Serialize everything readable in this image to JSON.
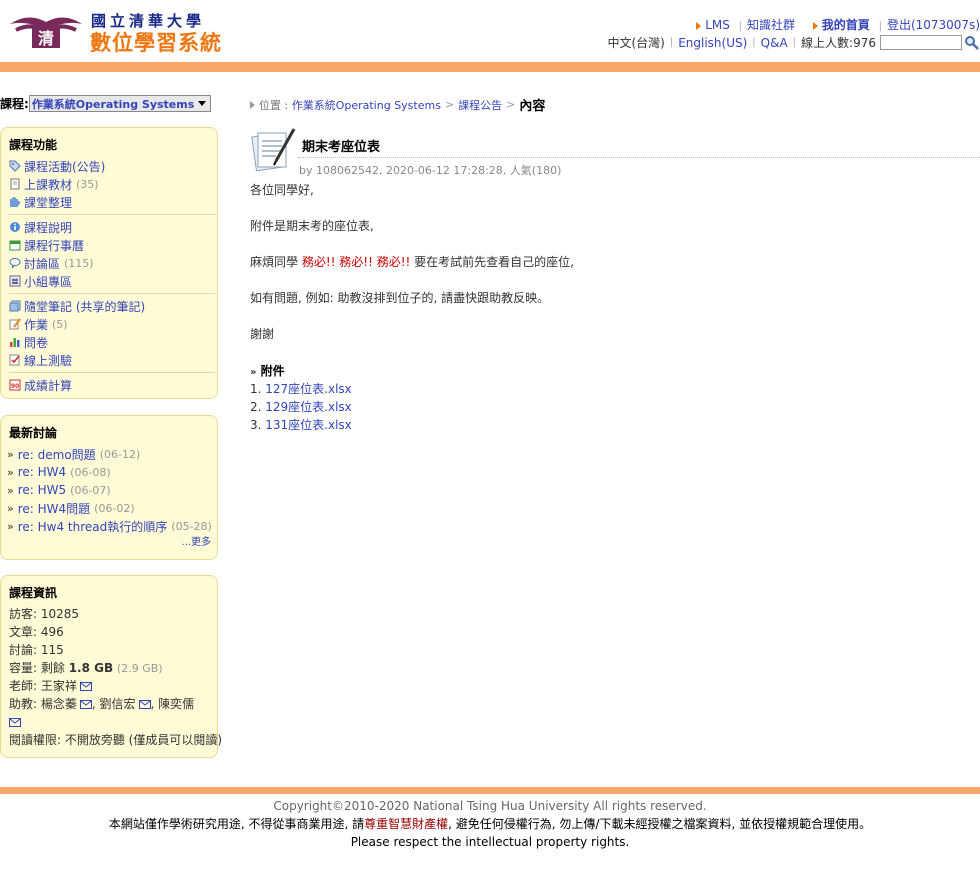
{
  "header": {
    "logo_line1": "國立清華大學",
    "logo_line2": "數位學習系統",
    "links_row1": {
      "lms": "LMS",
      "community": "知識社群",
      "home": "我的首頁",
      "logout": "登出(1073007s)"
    },
    "links_row2": {
      "lang_zh": "中文(台灣)",
      "lang_en": "English(US)",
      "qa": "Q&A",
      "online_users": "線上人數:976"
    },
    "search": {
      "value": "",
      "placeholder": ""
    }
  },
  "course": {
    "label": "課程:",
    "selected": "作業系統Operating Systems"
  },
  "functions_panel": {
    "title": "課程功能",
    "items": [
      {
        "label": "課程活動(公告)",
        "count": "",
        "icon": "tag-icon"
      },
      {
        "label": "上課教材",
        "count": "(35)",
        "icon": "document-icon"
      },
      {
        "label": "課堂整理",
        "count": "",
        "icon": "puzzle-icon"
      },
      {
        "label": "課程說明",
        "count": "",
        "icon": "info-icon"
      },
      {
        "label": "課程行事曆",
        "count": "",
        "icon": "calendar-icon"
      },
      {
        "label": "討論區",
        "count": "(115)",
        "icon": "speech-bubble-icon"
      },
      {
        "label": "小組專區",
        "count": "",
        "icon": "group-icon"
      },
      {
        "label": "隨堂筆記 (共享的筆記)",
        "count": "",
        "icon": "notes-icon"
      },
      {
        "label": "作業",
        "count": "(5)",
        "icon": "pencil-icon"
      },
      {
        "label": "問卷",
        "count": "",
        "icon": "bar-chart-icon"
      },
      {
        "label": "線上測驗",
        "count": "",
        "icon": "checklist-icon"
      },
      {
        "label": "成績計算",
        "count": "",
        "icon": "score-icon"
      }
    ]
  },
  "discussions_panel": {
    "title": "最新討論",
    "items": [
      {
        "label": "re: demo問題",
        "date": "(06-12)"
      },
      {
        "label": "re: HW4",
        "date": "(06-08)"
      },
      {
        "label": "re: HW5",
        "date": "(06-07)"
      },
      {
        "label": "re: HW4問題",
        "date": "(06-02)"
      },
      {
        "label": "re: Hw4 thread執行的順序",
        "date": "(05-28)"
      }
    ],
    "more": "...更多"
  },
  "info_panel": {
    "title": "課程資訊",
    "visitors": "訪客: 10285",
    "articles": "文章: 496",
    "discussions": "討論: 115",
    "capacity_label": "容量: 剩餘",
    "capacity_value": "1.8 GB",
    "capacity_total": "(2.9 GB)",
    "teacher": "老師: 王家祥",
    "ta_label": "助教: 楊念蓁",
    "ta2": "劉信宏",
    "ta3": "陳奕儒",
    "permission": "閱讀權限: 不開放旁聽 (僅成員可以閱讀)"
  },
  "breadcrumb": {
    "prefix": "位置 :",
    "course": "作業系統Operating Systems",
    "section": "課程公告",
    "current": "內容"
  },
  "post": {
    "title": "期末考座位表",
    "meta": "by 108062542, 2020-06-12 17:28:28, 人氣(180)",
    "greeting": "各位同學好,",
    "line1": "附件是期末考的座位表,",
    "line2_pre": "麻煩同學",
    "line2_red": "務必!! 務必!! 務必!!",
    "line2_post": "要在考試前先查看自己的座位,",
    "line3": "如有問題, 例如: 助教沒排到位子的, 請盡快跟助教反映。",
    "thanks": "謝謝",
    "attachments_title": "附件",
    "attachments": [
      {
        "num": "1.",
        "name": "127座位表.xlsx"
      },
      {
        "num": "2.",
        "name": "129座位表.xlsx"
      },
      {
        "num": "3.",
        "name": "131座位表.xlsx"
      }
    ]
  },
  "footer": {
    "copyright": "Copyright©2010-2020 National Tsing Hua University All rights reserved.",
    "notice_pre": "本網站僅作學術研究用途, 不得從事商業用途, 請",
    "notice_ip": "尊重智慧財產權",
    "notice_post": ", 避免任何侵權行為, 勿上傳/下載未經授權之檔案資料, 並依授權規範合理使用。",
    "respect": "Please respect the intellectual property rights."
  },
  "colors": {
    "accent_orange": "#f8a66a",
    "panel_bg": "#fffbd6",
    "link_blue": "#3344bb",
    "alert_red": "#cc0000"
  }
}
